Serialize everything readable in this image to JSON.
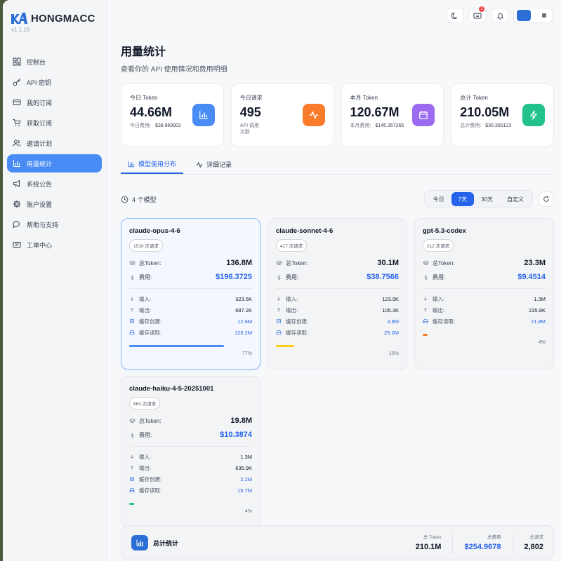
{
  "brand": {
    "name": "HONGMACC",
    "version": "v1.1.18"
  },
  "nav": [
    {
      "label": "控制台",
      "icon": "dashboard-icon",
      "active": false
    },
    {
      "label": "API 密钥",
      "icon": "key-icon",
      "active": false
    },
    {
      "label": "我的订阅",
      "icon": "credit-card-icon",
      "active": false
    },
    {
      "label": "获取订阅",
      "icon": "cart-icon",
      "active": false
    },
    {
      "label": "邀请计划",
      "icon": "users-icon",
      "active": false
    },
    {
      "label": "用量统计",
      "icon": "bar-chart-icon",
      "active": true
    },
    {
      "label": "系统公告",
      "icon": "megaphone-icon",
      "active": false
    },
    {
      "label": "账户设置",
      "icon": "gear-icon",
      "active": false
    },
    {
      "label": "帮助与支持",
      "icon": "chat-icon",
      "active": false
    },
    {
      "label": "工单中心",
      "icon": "ticket-icon",
      "active": false
    }
  ],
  "topbar": {
    "badge": "1"
  },
  "page": {
    "title": "用量统计",
    "subtitle": "查看你的 API 使用情况和费用明细"
  },
  "stats": [
    {
      "label": "今日 Token",
      "value": "44.66M",
      "note_label": "今日费用:",
      "note_value": "$38.969902",
      "color": "#4a8cf6",
      "icon": "bar-chart-icon"
    },
    {
      "label": "今日请求",
      "value": "495",
      "note_label": "API 调用次数",
      "note_value": "",
      "color": "#f97b2b",
      "icon": "activity-icon"
    },
    {
      "label": "本月 Token",
      "value": "120.67M",
      "note_label": "本月费用:",
      "note_value": "$145.357265",
      "color": "#9b6cf0",
      "icon": "calendar-icon"
    },
    {
      "label": "总计 Token",
      "value": "210.05M",
      "note_label": "总计费用:",
      "note_value": "$30.355123",
      "color": "#22c28a",
      "icon": "bolt-icon"
    }
  ],
  "tabs": [
    {
      "label": "模型使用分布",
      "active": true
    },
    {
      "label": "详细记录",
      "active": false
    }
  ],
  "toolbar": {
    "model_count": "4 个模型",
    "ranges": [
      {
        "label": "今日",
        "active": false
      },
      {
        "label": "7天",
        "active": true
      },
      {
        "label": "30天",
        "active": false
      },
      {
        "label": "自定义",
        "active": false
      }
    ]
  },
  "labels": {
    "total_token": "总Token:",
    "cost": "费用:",
    "input": "输入:",
    "output": "输出:",
    "cache_create": "缓存创建:",
    "cache_read": "缓存读取:"
  },
  "models": [
    {
      "name": "claude-opus-4-6",
      "requests": "1510 次请求",
      "token": "136.8M",
      "cost": "$196.3725",
      "input": "323.5K",
      "output": "687.2K",
      "cache_create": "12.6M",
      "cache_read": "123.2M",
      "percent": 77,
      "percent_label": "77%",
      "bar_color": "#4a8cf6",
      "selected": true
    },
    {
      "name": "claude-sonnet-4-6",
      "requests": "417 次请求",
      "token": "30.1M",
      "cost": "$38.7566",
      "input": "123.9K",
      "output": "105.3K",
      "cache_create": "4.9M",
      "cache_read": "25.0M",
      "percent": 15,
      "percent_label": "15%",
      "bar_color": "#facc15",
      "selected": false
    },
    {
      "name": "gpt-5.3-codex",
      "requests": "212 次请求",
      "token": "23.3M",
      "cost": "$9.4514",
      "input": "1.3M",
      "output": "235.8K",
      "cache_create": null,
      "cache_read": "21.8M",
      "percent": 4,
      "percent_label": "4%",
      "bar_color": "#f97b2b",
      "selected": false
    },
    {
      "name": "claude-haiku-4-5-20251001",
      "requests": "663 次请求",
      "token": "19.8M",
      "cost": "$10.3874",
      "input": "1.3M",
      "output": "635.9K",
      "cache_create": "2.2M",
      "cache_read": "15.7M",
      "percent": 4,
      "percent_label": "4%",
      "bar_color": "#22c28a",
      "selected": false
    }
  ],
  "total": {
    "title": "总计统计",
    "token_label": "总 Token",
    "token": "210.1M",
    "cost_label": "总费用",
    "cost": "$254.9678",
    "req_label": "总请求",
    "requests": "2,802"
  }
}
